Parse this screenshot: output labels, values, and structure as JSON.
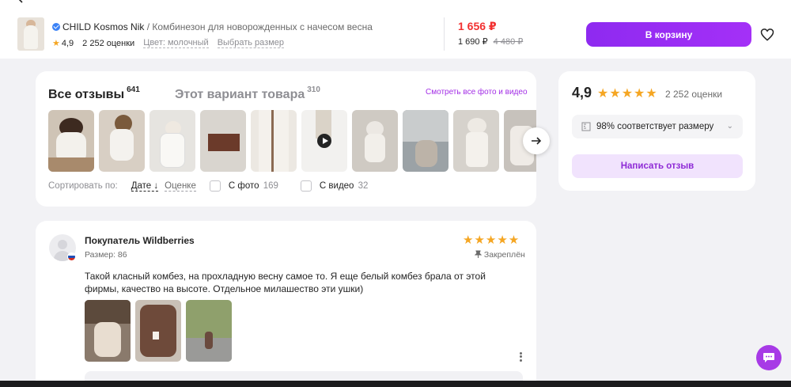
{
  "product_header": {
    "brand": "CHILD Kosmos Nik",
    "separator": "/",
    "product_name": "Комбинезон для новорожденных с начесом весна",
    "rating": "4,9",
    "ratings_count": "2 252 оценки",
    "color": "Цвет: молочный",
    "choose_size": "Выбрать размер",
    "price_now": "1 656 ₽",
    "price_wallet": "1 690 ₽",
    "price_old": "4 480 ₽",
    "cart_button": "В корзину"
  },
  "reviews": {
    "tab_all": "Все отзывы",
    "tab_all_count": "641",
    "tab_variant": "Этот вариант товара",
    "tab_variant_count": "310",
    "see_all_photos": "Смотреть все фото и видео",
    "sort_label": "Сортировать по:",
    "sort_date": "Дате ↓",
    "sort_rating": "Оценке",
    "with_photo": "С фото",
    "with_photo_count": "169",
    "with_video": "С видео",
    "with_video_count": "32"
  },
  "rating_summary": {
    "rating": "4,9",
    "stars": "★★★★★",
    "count": "2 252 оценки",
    "fit": "98% соответствует размеру",
    "write_review": "Написать отзыв"
  },
  "review": {
    "author": "Покупатель Wildberries",
    "size": "Размер: 86",
    "stars": "★★★★★",
    "pinned": "Закреплён",
    "text": "Такой класный комбез, на прохладную весну самое то. Я еще белый комбез брала от этой фирмы, качество на высоте. Отдельное милашество эти ушки)"
  },
  "colors": {
    "accent": "#9b27f5",
    "price_red": "#f23030",
    "star": "#f5a623",
    "link_purple": "#a32ee6"
  }
}
